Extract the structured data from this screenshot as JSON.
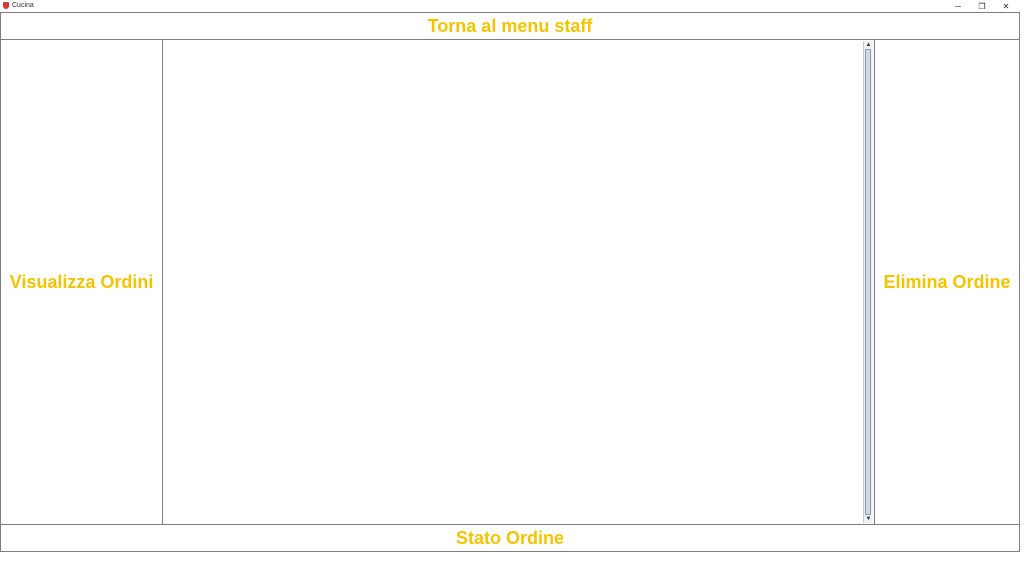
{
  "window": {
    "title": "Cucina",
    "controls": {
      "minimize": "─",
      "maximize": "❐",
      "close": "✕"
    }
  },
  "buttons": {
    "back_to_staff_menu": "Torna al menu staff",
    "view_orders": "Visualizza Ordini",
    "delete_order": "Elimina Ordine",
    "order_status": "Stato Ordine"
  },
  "orders_list": {
    "items": []
  },
  "colors": {
    "button_text": "#f5c400",
    "border": "#7a7f87",
    "background": "#ffffff"
  },
  "icons": {
    "app": "app-icon",
    "scroll_up": "▲",
    "scroll_down": "▼"
  }
}
